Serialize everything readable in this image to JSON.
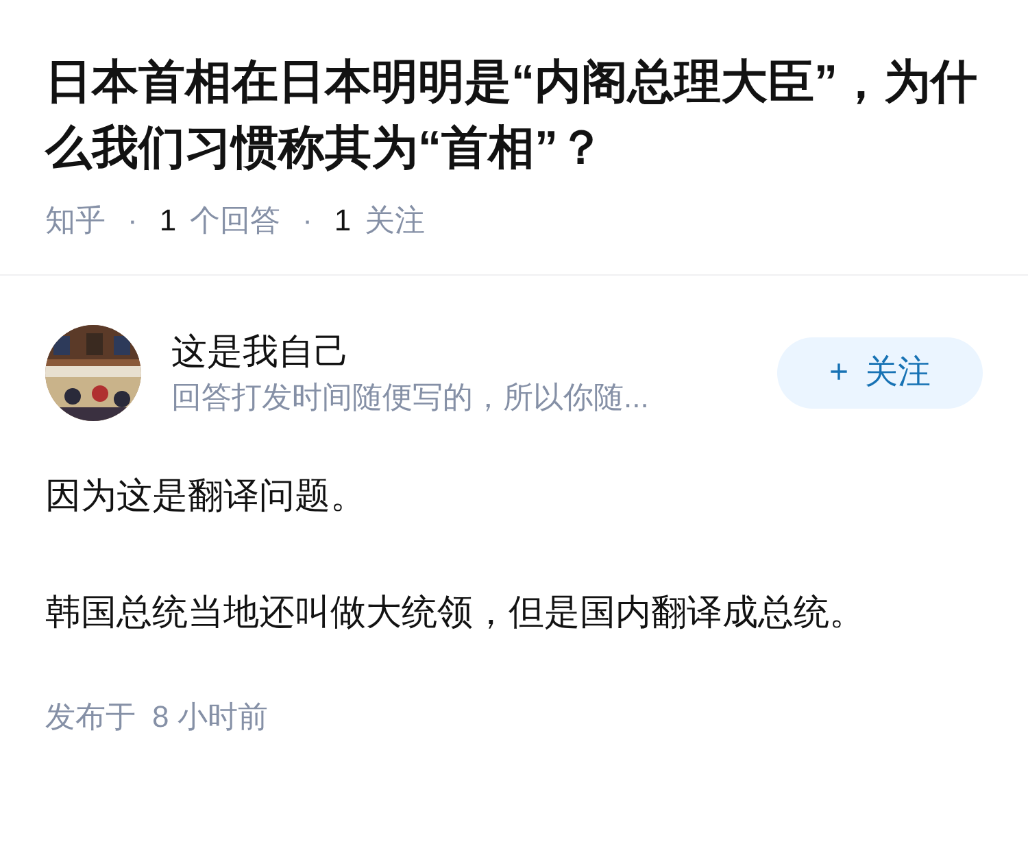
{
  "question": {
    "title": "日本首相在日本明明是“内阁总理大臣”，为什么我们习惯称其为“首相”？",
    "meta": [
      {
        "kind": "label",
        "text": "知乎"
      },
      {
        "kind": "separator",
        "text": "·"
      },
      {
        "kind": "count",
        "text": "1"
      },
      {
        "kind": "label",
        "text": "个回答"
      },
      {
        "kind": "separator",
        "text": "·"
      },
      {
        "kind": "count",
        "text": "1"
      },
      {
        "kind": "label",
        "text": "关注"
      }
    ]
  },
  "answer": {
    "author": {
      "name": "这是我自己",
      "bio": "回答打发时间随便写的，所以你随..."
    },
    "follow_button": {
      "icon": "+",
      "label": "关注"
    },
    "paragraphs": [
      "因为这是翻译问题。",
      "韩国总统当地还叫做大统领，但是国内翻译成总统。"
    ],
    "footer": {
      "label": "发布于",
      "time": "8 小时前"
    }
  }
}
